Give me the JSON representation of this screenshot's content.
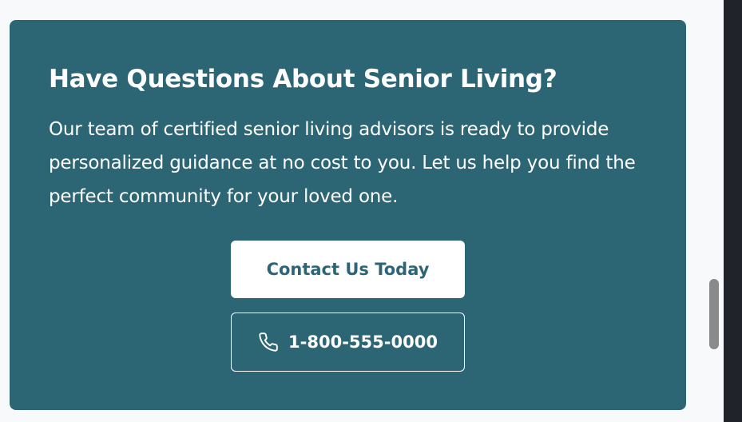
{
  "cta": {
    "title": "Have Questions About Senior Living?",
    "description": "Our team of certified senior living advisors is ready to provide personalized guidance at no cost to you. Let us help you find the perfect community for your loved one.",
    "primary_button_label": "Contact Us Today",
    "phone_button_label": "1-800-555-0000",
    "phone_icon": "phone-icon"
  },
  "colors": {
    "card_background": "#2c6675",
    "page_background": "#f8f9fb",
    "text": "#ffffff",
    "primary_button_bg": "#ffffff",
    "primary_button_text": "#2c6675"
  }
}
